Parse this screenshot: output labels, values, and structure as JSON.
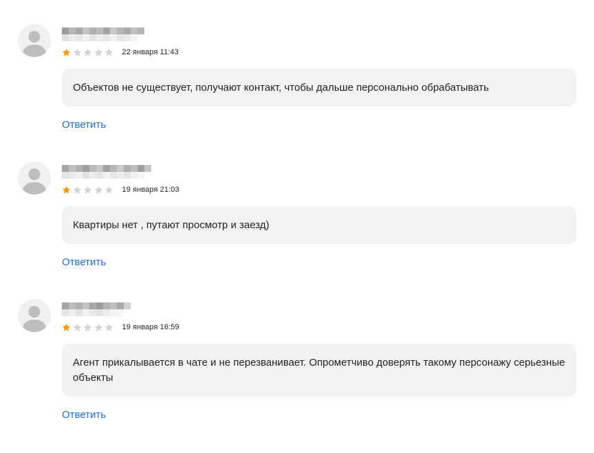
{
  "colors": {
    "star_filled": "#f59a0c",
    "star_empty": "#d4d4d4",
    "bubble_bg": "#f2f2f3",
    "link": "#1a6fd9"
  },
  "icons": {
    "avatar": "user-silhouette-icon",
    "star": "star-icon"
  },
  "reviews": [
    {
      "author": "",
      "rating": 1,
      "max_rating": 5,
      "date": "22 января 11:43",
      "text": "Объектов не существует, получают контакт, чтобы дальше персонально обрабатывать",
      "reply_label": "Ответить"
    },
    {
      "author": "",
      "rating": 1,
      "max_rating": 5,
      "date": "19 января 21:03",
      "text": "Квартиры нет , путают просмотр и заезд)",
      "reply_label": "Ответить"
    },
    {
      "author": "",
      "rating": 1,
      "max_rating": 5,
      "date": "19 января 16:59",
      "text": "Агент прикалывается в чате и не перезванивает. Опрометчиво доверять такому персонажу серьезные объекты",
      "reply_label": "Ответить"
    }
  ]
}
